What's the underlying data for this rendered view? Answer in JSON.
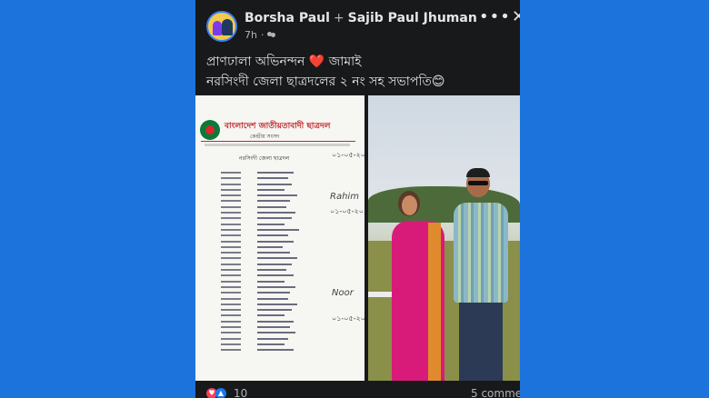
{
  "post": {
    "author": "Borsha Paul",
    "connector": "+",
    "tagged": "Sajib Paul Jhuman",
    "time": "7h",
    "audience_icon": "friends-icon",
    "more_icon": "•••",
    "close_icon": "✕",
    "caption_line1_a": "প্রাণঢালা অভিনন্দন",
    "caption_heart": "❤️",
    "caption_line1_b": "জামাই",
    "caption_line2": "নরসিংদী জেলা ছাত্রদলের ২ নং সহ সভাপতি😊"
  },
  "document": {
    "org_title": "বাংলাদেশ জাতীয়তাবাদী ছাত্রদল",
    "sub": "কেন্দ্রীয় সংসদ",
    "heading": "নরসিংদী জেলা ছাত্রদল",
    "date": "০১-০৫-২০"
  },
  "reactions": {
    "heart_icon": "♥",
    "like_icon": "👍",
    "count": "10"
  },
  "comments": "5 commen",
  "colors": {
    "background": "#1d73dc",
    "post_bg": "#18191a",
    "text": "#e4e6eb",
    "secondary": "#b0b3b8"
  }
}
